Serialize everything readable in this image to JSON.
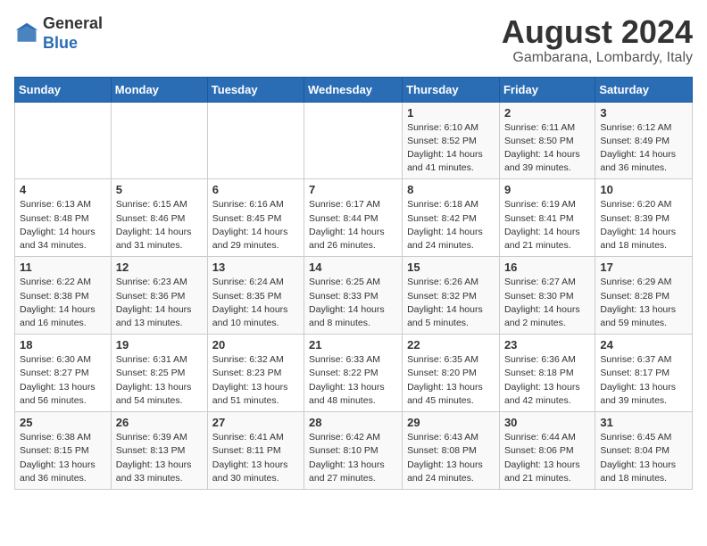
{
  "header": {
    "logo_line1": "General",
    "logo_line2": "Blue",
    "month_year": "August 2024",
    "location": "Gambarana, Lombardy, Italy"
  },
  "days_of_week": [
    "Sunday",
    "Monday",
    "Tuesday",
    "Wednesday",
    "Thursday",
    "Friday",
    "Saturday"
  ],
  "weeks": [
    [
      {
        "day": "",
        "info": ""
      },
      {
        "day": "",
        "info": ""
      },
      {
        "day": "",
        "info": ""
      },
      {
        "day": "",
        "info": ""
      },
      {
        "day": "1",
        "info": "Sunrise: 6:10 AM\nSunset: 8:52 PM\nDaylight: 14 hours and 41 minutes."
      },
      {
        "day": "2",
        "info": "Sunrise: 6:11 AM\nSunset: 8:50 PM\nDaylight: 14 hours and 39 minutes."
      },
      {
        "day": "3",
        "info": "Sunrise: 6:12 AM\nSunset: 8:49 PM\nDaylight: 14 hours and 36 minutes."
      }
    ],
    [
      {
        "day": "4",
        "info": "Sunrise: 6:13 AM\nSunset: 8:48 PM\nDaylight: 14 hours and 34 minutes."
      },
      {
        "day": "5",
        "info": "Sunrise: 6:15 AM\nSunset: 8:46 PM\nDaylight: 14 hours and 31 minutes."
      },
      {
        "day": "6",
        "info": "Sunrise: 6:16 AM\nSunset: 8:45 PM\nDaylight: 14 hours and 29 minutes."
      },
      {
        "day": "7",
        "info": "Sunrise: 6:17 AM\nSunset: 8:44 PM\nDaylight: 14 hours and 26 minutes."
      },
      {
        "day": "8",
        "info": "Sunrise: 6:18 AM\nSunset: 8:42 PM\nDaylight: 14 hours and 24 minutes."
      },
      {
        "day": "9",
        "info": "Sunrise: 6:19 AM\nSunset: 8:41 PM\nDaylight: 14 hours and 21 minutes."
      },
      {
        "day": "10",
        "info": "Sunrise: 6:20 AM\nSunset: 8:39 PM\nDaylight: 14 hours and 18 minutes."
      }
    ],
    [
      {
        "day": "11",
        "info": "Sunrise: 6:22 AM\nSunset: 8:38 PM\nDaylight: 14 hours and 16 minutes."
      },
      {
        "day": "12",
        "info": "Sunrise: 6:23 AM\nSunset: 8:36 PM\nDaylight: 14 hours and 13 minutes."
      },
      {
        "day": "13",
        "info": "Sunrise: 6:24 AM\nSunset: 8:35 PM\nDaylight: 14 hours and 10 minutes."
      },
      {
        "day": "14",
        "info": "Sunrise: 6:25 AM\nSunset: 8:33 PM\nDaylight: 14 hours and 8 minutes."
      },
      {
        "day": "15",
        "info": "Sunrise: 6:26 AM\nSunset: 8:32 PM\nDaylight: 14 hours and 5 minutes."
      },
      {
        "day": "16",
        "info": "Sunrise: 6:27 AM\nSunset: 8:30 PM\nDaylight: 14 hours and 2 minutes."
      },
      {
        "day": "17",
        "info": "Sunrise: 6:29 AM\nSunset: 8:28 PM\nDaylight: 13 hours and 59 minutes."
      }
    ],
    [
      {
        "day": "18",
        "info": "Sunrise: 6:30 AM\nSunset: 8:27 PM\nDaylight: 13 hours and 56 minutes."
      },
      {
        "day": "19",
        "info": "Sunrise: 6:31 AM\nSunset: 8:25 PM\nDaylight: 13 hours and 54 minutes."
      },
      {
        "day": "20",
        "info": "Sunrise: 6:32 AM\nSunset: 8:23 PM\nDaylight: 13 hours and 51 minutes."
      },
      {
        "day": "21",
        "info": "Sunrise: 6:33 AM\nSunset: 8:22 PM\nDaylight: 13 hours and 48 minutes."
      },
      {
        "day": "22",
        "info": "Sunrise: 6:35 AM\nSunset: 8:20 PM\nDaylight: 13 hours and 45 minutes."
      },
      {
        "day": "23",
        "info": "Sunrise: 6:36 AM\nSunset: 8:18 PM\nDaylight: 13 hours and 42 minutes."
      },
      {
        "day": "24",
        "info": "Sunrise: 6:37 AM\nSunset: 8:17 PM\nDaylight: 13 hours and 39 minutes."
      }
    ],
    [
      {
        "day": "25",
        "info": "Sunrise: 6:38 AM\nSunset: 8:15 PM\nDaylight: 13 hours and 36 minutes."
      },
      {
        "day": "26",
        "info": "Sunrise: 6:39 AM\nSunset: 8:13 PM\nDaylight: 13 hours and 33 minutes."
      },
      {
        "day": "27",
        "info": "Sunrise: 6:41 AM\nSunset: 8:11 PM\nDaylight: 13 hours and 30 minutes."
      },
      {
        "day": "28",
        "info": "Sunrise: 6:42 AM\nSunset: 8:10 PM\nDaylight: 13 hours and 27 minutes."
      },
      {
        "day": "29",
        "info": "Sunrise: 6:43 AM\nSunset: 8:08 PM\nDaylight: 13 hours and 24 minutes."
      },
      {
        "day": "30",
        "info": "Sunrise: 6:44 AM\nSunset: 8:06 PM\nDaylight: 13 hours and 21 minutes."
      },
      {
        "day": "31",
        "info": "Sunrise: 6:45 AM\nSunset: 8:04 PM\nDaylight: 13 hours and 18 minutes."
      }
    ]
  ]
}
